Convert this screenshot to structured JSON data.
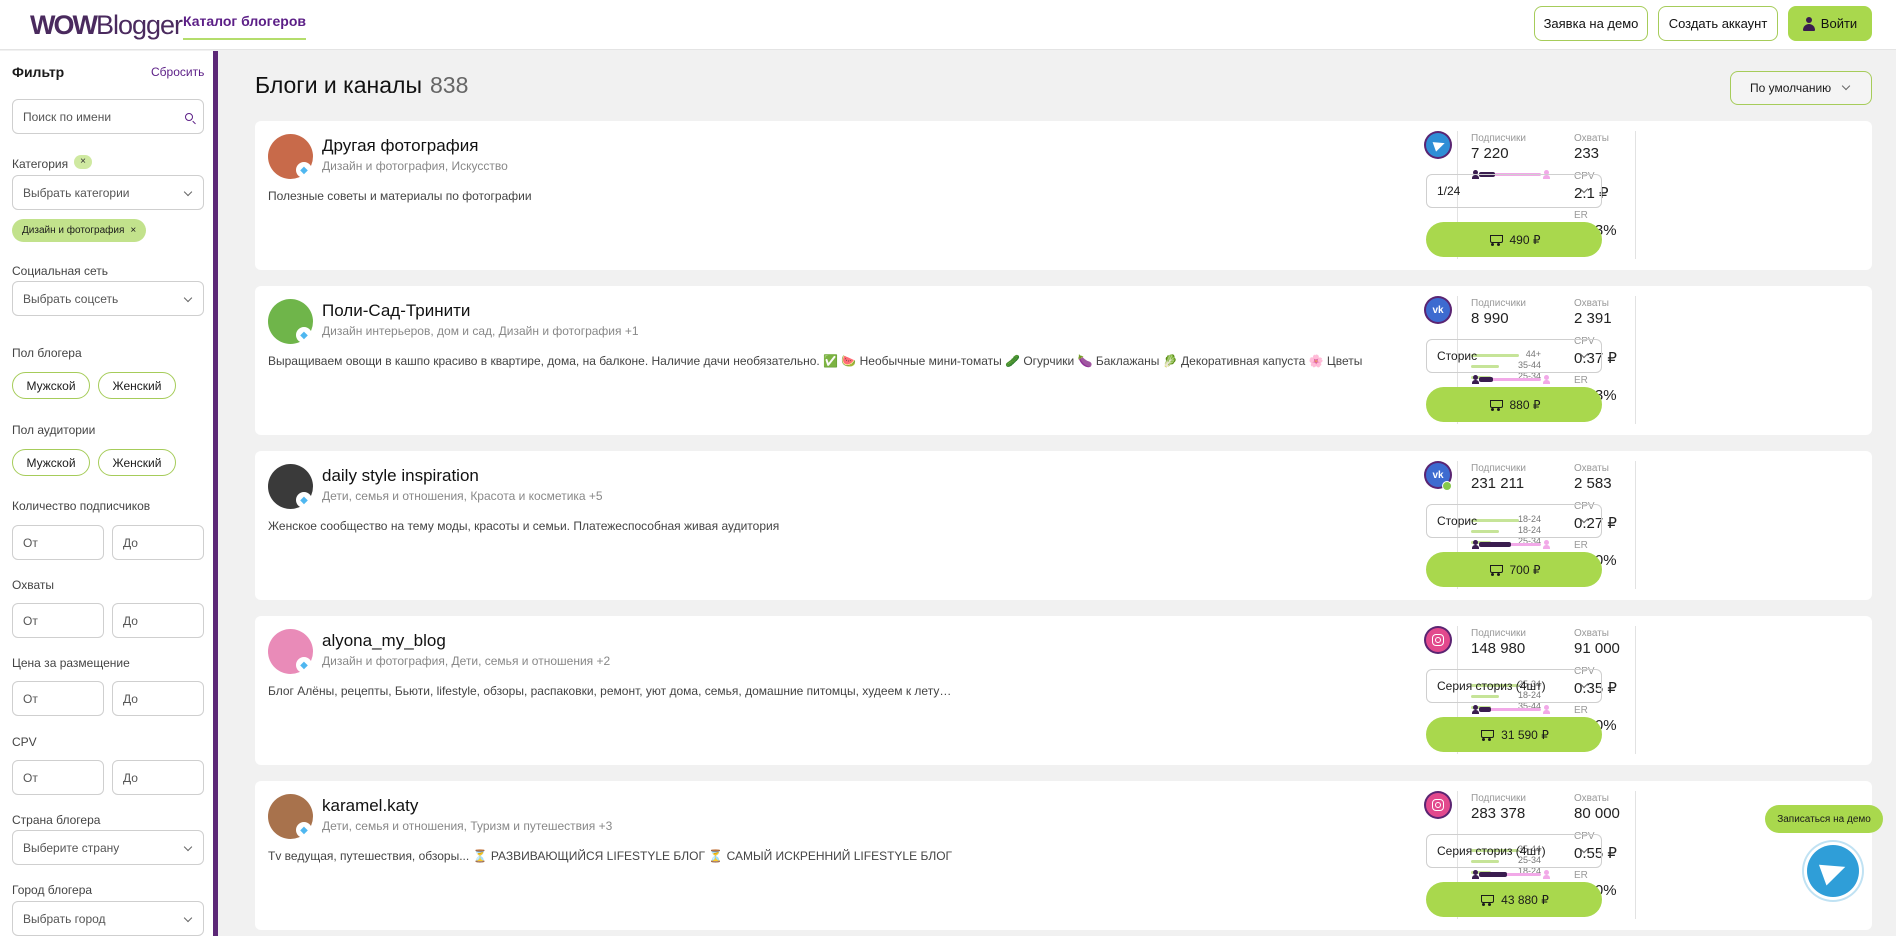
{
  "header": {
    "logo_bold": "WOW",
    "logo_rest": "Blogger",
    "nav_catalog": "Каталог блогеров",
    "demo_button": "Заявка на демо",
    "create_button": "Создать аккаунт",
    "login_button": "Войти"
  },
  "sidebar": {
    "title": "Фильтр",
    "reset": "Сбросить",
    "search_placeholder": "Поиск по имени",
    "category_label": "Категория",
    "category_clear": "×",
    "category_select": "Выбрать категории",
    "selected_chip": "Дизайн и фотография",
    "chip_x": "×",
    "social_label": "Социальная сеть",
    "social_select": "Выбрать соцсеть",
    "blogger_gender_label": "Пол блогера",
    "audience_gender_label": "Пол аудитории",
    "male": "Мужской",
    "female": "Женский",
    "subscribers_label": "Количество подписчиков",
    "reach_label": "Охваты",
    "price_label": "Цена за размещение",
    "cpv_label": "CPV",
    "from": "От",
    "to": "До",
    "country_label": "Страна блогера",
    "country_select": "Выберите страну",
    "city_label": "Город блогера",
    "city_select": "Выбрать город"
  },
  "main": {
    "title": "Блоги и каналы",
    "count": "838",
    "sort": "По умолчанию"
  },
  "labels": {
    "subscribers": "Подписчики",
    "reach": "Охваты",
    "cpv": "CPV",
    "er": "ER"
  },
  "cards": [
    {
      "name": "Другая фотография",
      "cats": "Дизайн и фотография,  Искусство",
      "desc": "Полезные советы и материалы по фотографии",
      "subscribers": "7 220",
      "reach": "233",
      "cpv": "2.1 ₽",
      "er": "0.83%",
      "network": "telegram-icon",
      "format": "1/24",
      "price": "490 ₽",
      "ages": [],
      "male_share": 0.25,
      "avatar_color": "#c86a4a"
    },
    {
      "name": "Поли-Сад-Тринити",
      "cats": "Дизайн интерьеров, дом и сад,  Дизайн и фотография   +1",
      "desc": "Выращиваем овощи в кашпо красиво в квартире, дома, на балконе. Наличие дачи необязательно. ✅ 🍉 Необычные мини-томаты 🥒 Огурчики 🍆 Баклажаны 🥬 Декоративная капуста 🌸 Цветы",
      "subscribers": "8 990",
      "reach": "2 391",
      "cpv": "0.37 ₽",
      "er": "4.63%",
      "network": "vk-icon",
      "format": "Сторис",
      "price": "880 ₽",
      "ages": [
        "44+",
        "35-44",
        "25-34"
      ],
      "male_share": 0.22,
      "avatar_color": "#6fb54a"
    },
    {
      "name": "daily style inspiration",
      "cats": "Дети, семья и отношения,  Красота и косметика     +5",
      "desc": "Женское сообщество на тему моды, красоты и семьи. Платежеспособная живая аудитория",
      "subscribers": "231 211",
      "reach": "2 583",
      "cpv": "0.27 ₽",
      "er": "1.00%",
      "network": "vk-icon",
      "format": "Сторис",
      "price": "700 ₽",
      "ages": [
        "18-24",
        "18-24",
        "25-34"
      ],
      "male_share": 0.52,
      "avatar_color": "#3a3a3a"
    },
    {
      "name": "alyona_my_blog",
      "cats": "Дизайн и фотография,  Дети, семья и отношения   +2",
      "desc": "Блог Алёны, рецепты, Бьюти, lifestyle, обзоры, распаковки, ремонт, уют дома, семья, домашние питомцы, худеем к лету…",
      "subscribers": "148 980",
      "reach": "91 000",
      "cpv": "0.35 ₽",
      "er": "3.40%",
      "network": "instagram-icon",
      "format": "Серия сториз (4шт)",
      "price": "31 590 ₽",
      "ages": [
        "25-34",
        "18-24",
        "35-44"
      ],
      "male_share": 0.2,
      "avatar_color": "#e98bb8"
    },
    {
      "name": "karamel.katy",
      "cats": "Дети, семья и отношения,  Туризм и путешествия   +3",
      "desc": "Tv ведущая, путешествия, обзоры... ⏳ РАЗВИВАЮЩИЙСЯ LIFESTYLE БЛОГ ⏳ САМЫЙ ИСКРЕННИЙ LIFESTYLE БЛОГ",
      "subscribers": "283 378",
      "reach": "80 000",
      "cpv": "0.55 ₽",
      "er": "0.50%",
      "network": "instagram-icon",
      "format": "Серия сториз (4шт)",
      "price": "43 880 ₽",
      "ages": [
        "35-44",
        "25-34",
        "18-24"
      ],
      "male_share": 0.45,
      "avatar_color": "#a8724c"
    }
  ],
  "floating": {
    "demo": "Записаться на демо"
  }
}
